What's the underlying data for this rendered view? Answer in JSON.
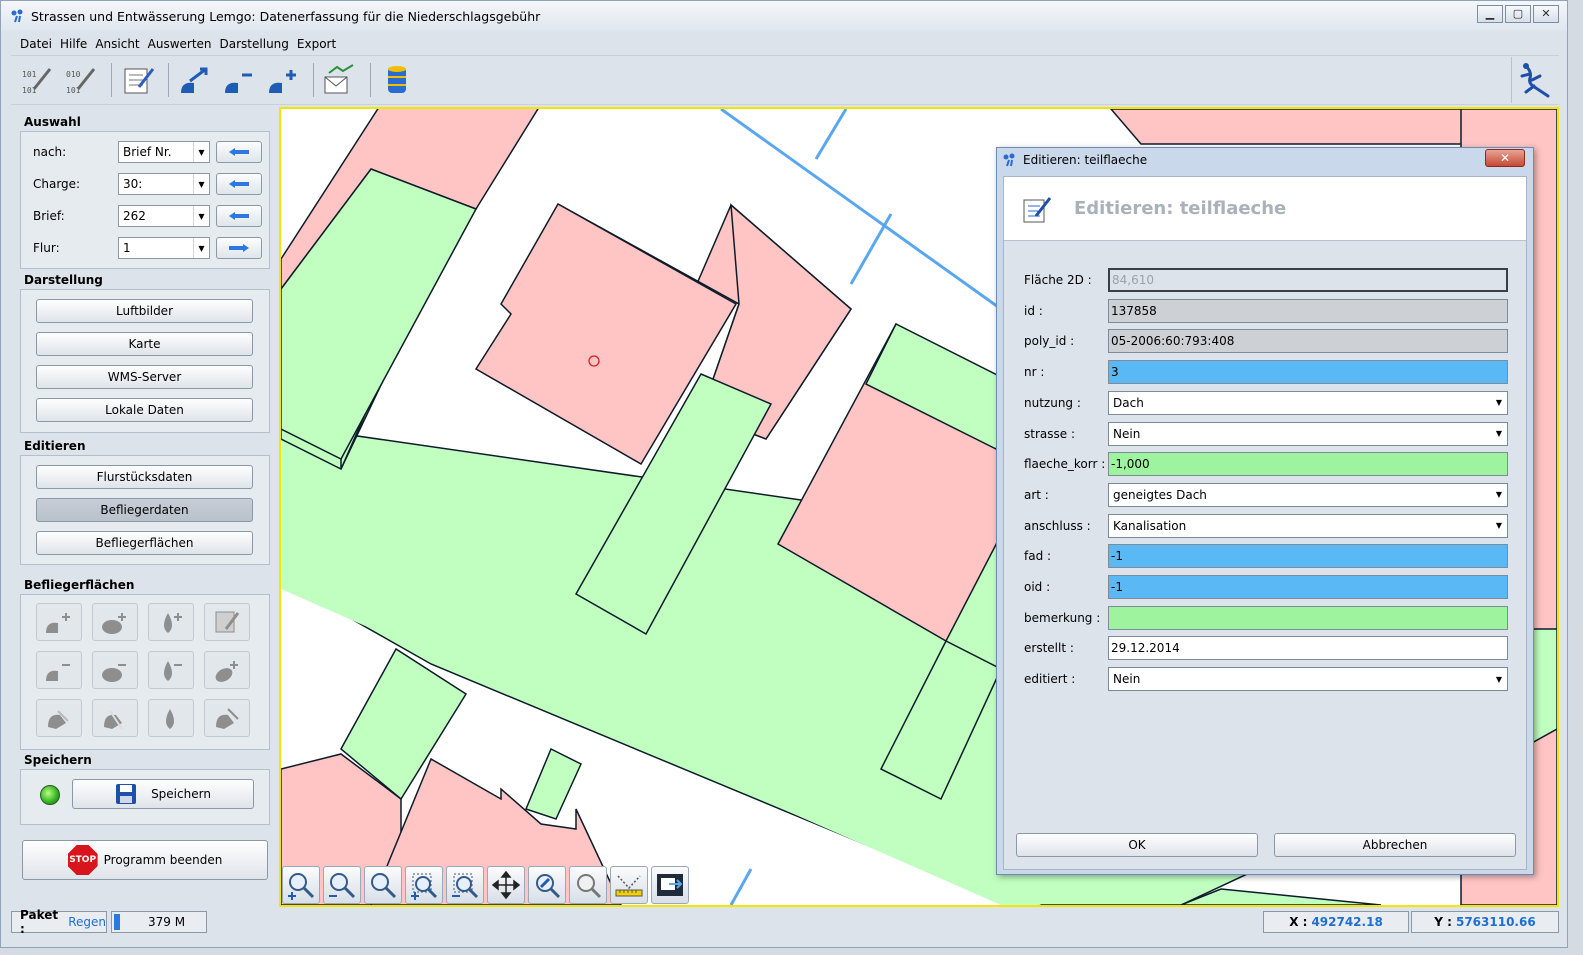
{
  "window": {
    "title": "Strassen und Entwässerung Lemgo: Datenerfassung für die Niederschlagsgebühr",
    "controls": [
      "▁",
      "▢",
      "✕"
    ]
  },
  "menu": [
    "Datei",
    "Hilfe",
    "Ansicht",
    "Auswerten",
    "Darstellung",
    "Export"
  ],
  "toolbar": {
    "icons": [
      "binary-edit-icon",
      "binary-edit-2-icon",
      "form-edit-icon",
      "area-transfer-icon",
      "area-remove-icon",
      "area-add-icon",
      "mail-chart-icon",
      "database-icon"
    ],
    "right_icon": "lizard-icon"
  },
  "auswahl": {
    "title": "Auswahl",
    "rows": [
      {
        "label": "nach:",
        "value": "Brief Nr."
      },
      {
        "label": "Charge:",
        "value": "30:"
      },
      {
        "label": "Brief:",
        "value": "262"
      },
      {
        "label": "Flur:",
        "value": "1"
      }
    ]
  },
  "darstellung": {
    "title": "Darstellung",
    "buttons": [
      "Luftbilder",
      "Karte",
      "WMS-Server",
      "Lokale Daten"
    ]
  },
  "editieren": {
    "title": "Editieren",
    "buttons": [
      "Flurstücksdaten",
      "Befliegerdaten",
      "Befliegerflächen"
    ]
  },
  "befliegerflaechen": {
    "title": "Befliegerflächen"
  },
  "speichern": {
    "title": "Speichern",
    "button": "Speichern"
  },
  "quit": {
    "label": "Programm beenden",
    "stop_text": "STOP"
  },
  "status": {
    "paket_label": "Paket :",
    "paket_value": "Regen",
    "memory": "379 M",
    "x_label": "X :",
    "x_value": "492742.18",
    "y_label": "Y :",
    "y_value": "5763110.66"
  },
  "colors": {
    "roof": "#ffc4c4",
    "green": "#c0ffc0",
    "blue_line": "#5aa7ef",
    "field_blue": "#5ab9f5",
    "field_green": "#9ef39e"
  },
  "dialog": {
    "window_title": "Editieren: teilflaeche",
    "heading": "Editieren: teilflaeche",
    "fields": [
      {
        "label": "Fläche 2D :",
        "value": "84,610",
        "type": "readonly"
      },
      {
        "label": "id :",
        "value": "137858",
        "type": "gray"
      },
      {
        "label": "poly_id :",
        "value": "05-2006:60:793:408",
        "type": "gray"
      },
      {
        "label": "nr :",
        "value": "3",
        "type": "blue"
      },
      {
        "label": "nutzung :",
        "value": "Dach",
        "type": "select"
      },
      {
        "label": "strasse :",
        "value": "Nein",
        "type": "select"
      },
      {
        "label": "flaeche_korr :",
        "value": "-1,000",
        "type": "green"
      },
      {
        "label": "art :",
        "value": "geneigtes Dach",
        "type": "select"
      },
      {
        "label": "anschluss :",
        "value": "Kanalisation",
        "type": "select"
      },
      {
        "label": "fad :",
        "value": "-1",
        "type": "blue"
      },
      {
        "label": "oid :",
        "value": "-1",
        "type": "blue"
      },
      {
        "label": "bemerkung :",
        "value": "",
        "type": "green"
      },
      {
        "label": "erstellt :",
        "value": "29.12.2014",
        "type": "white"
      },
      {
        "label": "editiert :",
        "value": "Nein",
        "type": "select"
      }
    ],
    "ok": "OK",
    "cancel": "Abbrechen"
  }
}
